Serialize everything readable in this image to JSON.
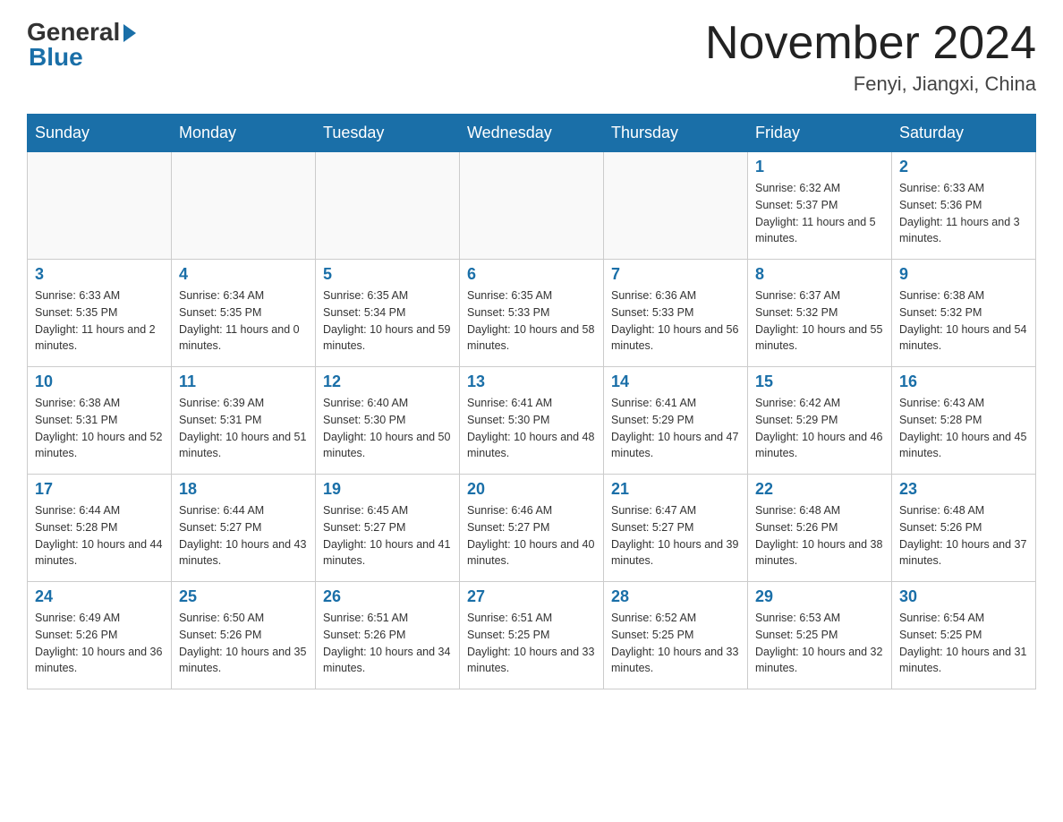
{
  "header": {
    "logo_general": "General",
    "logo_blue": "Blue",
    "month_title": "November 2024",
    "location": "Fenyi, Jiangxi, China"
  },
  "weekdays": [
    "Sunday",
    "Monday",
    "Tuesday",
    "Wednesday",
    "Thursday",
    "Friday",
    "Saturday"
  ],
  "weeks": [
    [
      {
        "day": "",
        "info": ""
      },
      {
        "day": "",
        "info": ""
      },
      {
        "day": "",
        "info": ""
      },
      {
        "day": "",
        "info": ""
      },
      {
        "day": "",
        "info": ""
      },
      {
        "day": "1",
        "info": "Sunrise: 6:32 AM\nSunset: 5:37 PM\nDaylight: 11 hours and 5 minutes."
      },
      {
        "day": "2",
        "info": "Sunrise: 6:33 AM\nSunset: 5:36 PM\nDaylight: 11 hours and 3 minutes."
      }
    ],
    [
      {
        "day": "3",
        "info": "Sunrise: 6:33 AM\nSunset: 5:35 PM\nDaylight: 11 hours and 2 minutes."
      },
      {
        "day": "4",
        "info": "Sunrise: 6:34 AM\nSunset: 5:35 PM\nDaylight: 11 hours and 0 minutes."
      },
      {
        "day": "5",
        "info": "Sunrise: 6:35 AM\nSunset: 5:34 PM\nDaylight: 10 hours and 59 minutes."
      },
      {
        "day": "6",
        "info": "Sunrise: 6:35 AM\nSunset: 5:33 PM\nDaylight: 10 hours and 58 minutes."
      },
      {
        "day": "7",
        "info": "Sunrise: 6:36 AM\nSunset: 5:33 PM\nDaylight: 10 hours and 56 minutes."
      },
      {
        "day": "8",
        "info": "Sunrise: 6:37 AM\nSunset: 5:32 PM\nDaylight: 10 hours and 55 minutes."
      },
      {
        "day": "9",
        "info": "Sunrise: 6:38 AM\nSunset: 5:32 PM\nDaylight: 10 hours and 54 minutes."
      }
    ],
    [
      {
        "day": "10",
        "info": "Sunrise: 6:38 AM\nSunset: 5:31 PM\nDaylight: 10 hours and 52 minutes."
      },
      {
        "day": "11",
        "info": "Sunrise: 6:39 AM\nSunset: 5:31 PM\nDaylight: 10 hours and 51 minutes."
      },
      {
        "day": "12",
        "info": "Sunrise: 6:40 AM\nSunset: 5:30 PM\nDaylight: 10 hours and 50 minutes."
      },
      {
        "day": "13",
        "info": "Sunrise: 6:41 AM\nSunset: 5:30 PM\nDaylight: 10 hours and 48 minutes."
      },
      {
        "day": "14",
        "info": "Sunrise: 6:41 AM\nSunset: 5:29 PM\nDaylight: 10 hours and 47 minutes."
      },
      {
        "day": "15",
        "info": "Sunrise: 6:42 AM\nSunset: 5:29 PM\nDaylight: 10 hours and 46 minutes."
      },
      {
        "day": "16",
        "info": "Sunrise: 6:43 AM\nSunset: 5:28 PM\nDaylight: 10 hours and 45 minutes."
      }
    ],
    [
      {
        "day": "17",
        "info": "Sunrise: 6:44 AM\nSunset: 5:28 PM\nDaylight: 10 hours and 44 minutes."
      },
      {
        "day": "18",
        "info": "Sunrise: 6:44 AM\nSunset: 5:27 PM\nDaylight: 10 hours and 43 minutes."
      },
      {
        "day": "19",
        "info": "Sunrise: 6:45 AM\nSunset: 5:27 PM\nDaylight: 10 hours and 41 minutes."
      },
      {
        "day": "20",
        "info": "Sunrise: 6:46 AM\nSunset: 5:27 PM\nDaylight: 10 hours and 40 minutes."
      },
      {
        "day": "21",
        "info": "Sunrise: 6:47 AM\nSunset: 5:27 PM\nDaylight: 10 hours and 39 minutes."
      },
      {
        "day": "22",
        "info": "Sunrise: 6:48 AM\nSunset: 5:26 PM\nDaylight: 10 hours and 38 minutes."
      },
      {
        "day": "23",
        "info": "Sunrise: 6:48 AM\nSunset: 5:26 PM\nDaylight: 10 hours and 37 minutes."
      }
    ],
    [
      {
        "day": "24",
        "info": "Sunrise: 6:49 AM\nSunset: 5:26 PM\nDaylight: 10 hours and 36 minutes."
      },
      {
        "day": "25",
        "info": "Sunrise: 6:50 AM\nSunset: 5:26 PM\nDaylight: 10 hours and 35 minutes."
      },
      {
        "day": "26",
        "info": "Sunrise: 6:51 AM\nSunset: 5:26 PM\nDaylight: 10 hours and 34 minutes."
      },
      {
        "day": "27",
        "info": "Sunrise: 6:51 AM\nSunset: 5:25 PM\nDaylight: 10 hours and 33 minutes."
      },
      {
        "day": "28",
        "info": "Sunrise: 6:52 AM\nSunset: 5:25 PM\nDaylight: 10 hours and 33 minutes."
      },
      {
        "day": "29",
        "info": "Sunrise: 6:53 AM\nSunset: 5:25 PM\nDaylight: 10 hours and 32 minutes."
      },
      {
        "day": "30",
        "info": "Sunrise: 6:54 AM\nSunset: 5:25 PM\nDaylight: 10 hours and 31 minutes."
      }
    ]
  ]
}
